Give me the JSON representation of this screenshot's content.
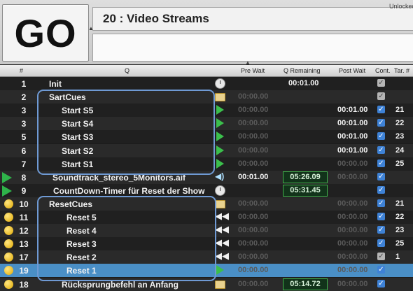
{
  "go_label": "GO",
  "workspace": {
    "title": "20 : Video Streams",
    "status": "Unlocked"
  },
  "columns": [
    "#",
    "Q",
    "Pre Wait",
    "Q Remaining",
    "Post Wait",
    "Cont.",
    "Tar. #"
  ],
  "rows": [
    {
      "num": "1",
      "name": "Init",
      "status": "",
      "icon": "clock-icon",
      "pre": "",
      "remain": "00:01.00",
      "remain_box": false,
      "post": "",
      "cont": "gray",
      "tar": ""
    },
    {
      "num": "2",
      "name": "SartCues",
      "status": "",
      "icon": "folder-icon",
      "pre": "00:00.00",
      "remain": "",
      "remain_box": false,
      "post": "",
      "cont": "gray",
      "tar": ""
    },
    {
      "num": "3",
      "name": "Start S5",
      "status": "",
      "icon": "start-icon",
      "pre": "00:00.00",
      "remain": "",
      "remain_box": false,
      "post": "00:01.00",
      "cont": "on",
      "tar": "21"
    },
    {
      "num": "3",
      "name": "Start S4",
      "status": "",
      "icon": "start-icon",
      "pre": "00:00.00",
      "remain": "",
      "remain_box": false,
      "post": "00:01.00",
      "cont": "on",
      "tar": "22"
    },
    {
      "num": "5",
      "name": "Start S3",
      "status": "",
      "icon": "start-icon",
      "pre": "00:00.00",
      "remain": "",
      "remain_box": false,
      "post": "00:01.00",
      "cont": "on",
      "tar": "23"
    },
    {
      "num": "6",
      "name": "Start S2",
      "status": "",
      "icon": "start-icon",
      "pre": "00:00.00",
      "remain": "",
      "remain_box": false,
      "post": "00:01.00",
      "cont": "on",
      "tar": "24"
    },
    {
      "num": "7",
      "name": "Start S1",
      "status": "",
      "icon": "start-icon",
      "pre": "00:00.00",
      "remain": "",
      "remain_box": false,
      "post": "00:00.00",
      "cont": "on",
      "tar": "25"
    },
    {
      "num": "8",
      "name": "Soundtrack_stereo_5Monitors.aif",
      "status": "play",
      "icon": "audio-icon",
      "pre": "00:01.00",
      "remain": "05:26.09",
      "remain_box": true,
      "post": "00:00.00",
      "cont": "on",
      "tar": ""
    },
    {
      "num": "9",
      "name": "CountDown-Timer für Reset der Show",
      "status": "play",
      "icon": "clock-icon",
      "pre": "",
      "remain": "05:31.45",
      "remain_box": true,
      "post": "",
      "cont": "on",
      "tar": ""
    },
    {
      "num": "10",
      "name": "ResetCues",
      "status": "dot",
      "icon": "folder-icon",
      "pre": "00:00.00",
      "remain": "",
      "remain_box": false,
      "post": "00:00.00",
      "cont": "on",
      "tar": "21"
    },
    {
      "num": "11",
      "name": "Reset 5",
      "status": "dot",
      "icon": "reset-icon",
      "pre": "00:00.00",
      "remain": "",
      "remain_box": false,
      "post": "00:00.00",
      "cont": "on",
      "tar": "22"
    },
    {
      "num": "12",
      "name": "Reset 4",
      "status": "dot",
      "icon": "reset-icon",
      "pre": "00:00.00",
      "remain": "",
      "remain_box": false,
      "post": "00:00.00",
      "cont": "on",
      "tar": "23"
    },
    {
      "num": "13",
      "name": "Reset 3",
      "status": "dot",
      "icon": "reset-icon",
      "pre": "00:00.00",
      "remain": "",
      "remain_box": false,
      "post": "00:00.00",
      "cont": "on",
      "tar": "25"
    },
    {
      "num": "17",
      "name": "Reset 2",
      "status": "dot",
      "icon": "reset-icon",
      "pre": "00:00.00",
      "remain": "",
      "remain_box": false,
      "post": "00:00.00",
      "cont": "gray",
      "tar": "1"
    },
    {
      "num": "19",
      "name": "Reset 1",
      "status": "dot",
      "icon": "start-icon",
      "pre": "00:00.00",
      "remain": "",
      "remain_box": false,
      "post": "00:00.00",
      "cont": "on",
      "tar": "",
      "hl": true
    },
    {
      "num": "18",
      "name": "Rücksprungbefehl an Anfang",
      "status": "dot",
      "icon": "folder-icon",
      "pre": "00:00.00",
      "remain": "05:14.72",
      "remain_box": true,
      "post": "00:00.00",
      "cont": "on",
      "tar": ""
    }
  ]
}
